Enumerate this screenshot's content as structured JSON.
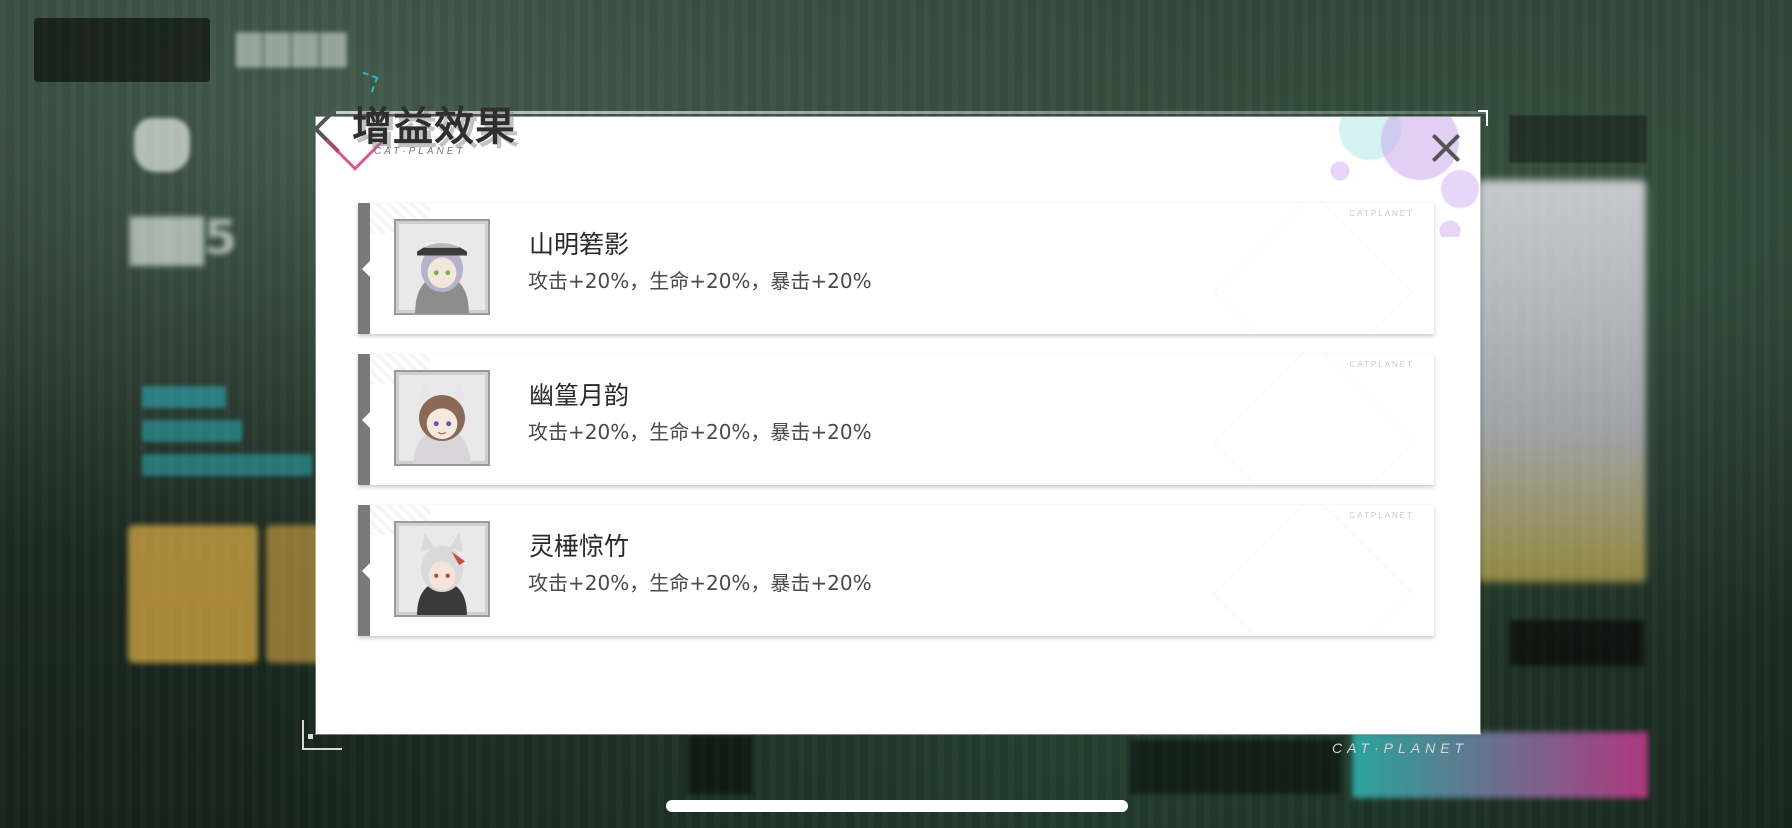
{
  "modal": {
    "title": "增益效果",
    "subtitle": "CAT·PLANET",
    "close_icon": "close-icon"
  },
  "buffs": [
    {
      "name": "山明箬影",
      "effect": "攻击+20%，生命+20%，暴击+20%",
      "card_brand": "CATPLANET",
      "portrait_hair": "#b7b2c9",
      "portrait_hat": "#3a3a3a"
    },
    {
      "name": "幽篁月韵",
      "effect": "攻击+20%，生命+20%，暴击+20%",
      "card_brand": "CATPLANET",
      "portrait_hair": "#8a6a57",
      "portrait_hat": "#e8e4ea"
    },
    {
      "name": "灵棰惊竹",
      "effect": "攻击+20%，生命+20%，暴击+20%",
      "card_brand": "CATPLANET",
      "portrait_hair": "#d9d9d9",
      "portrait_hat": "#c94a3a"
    }
  ],
  "footer": {
    "brand": "CAT·PLANET"
  },
  "colors": {
    "accent_pink": "#d23b88",
    "accent_cyan": "#2db7c4",
    "card_bar": "#7a7a7a"
  }
}
